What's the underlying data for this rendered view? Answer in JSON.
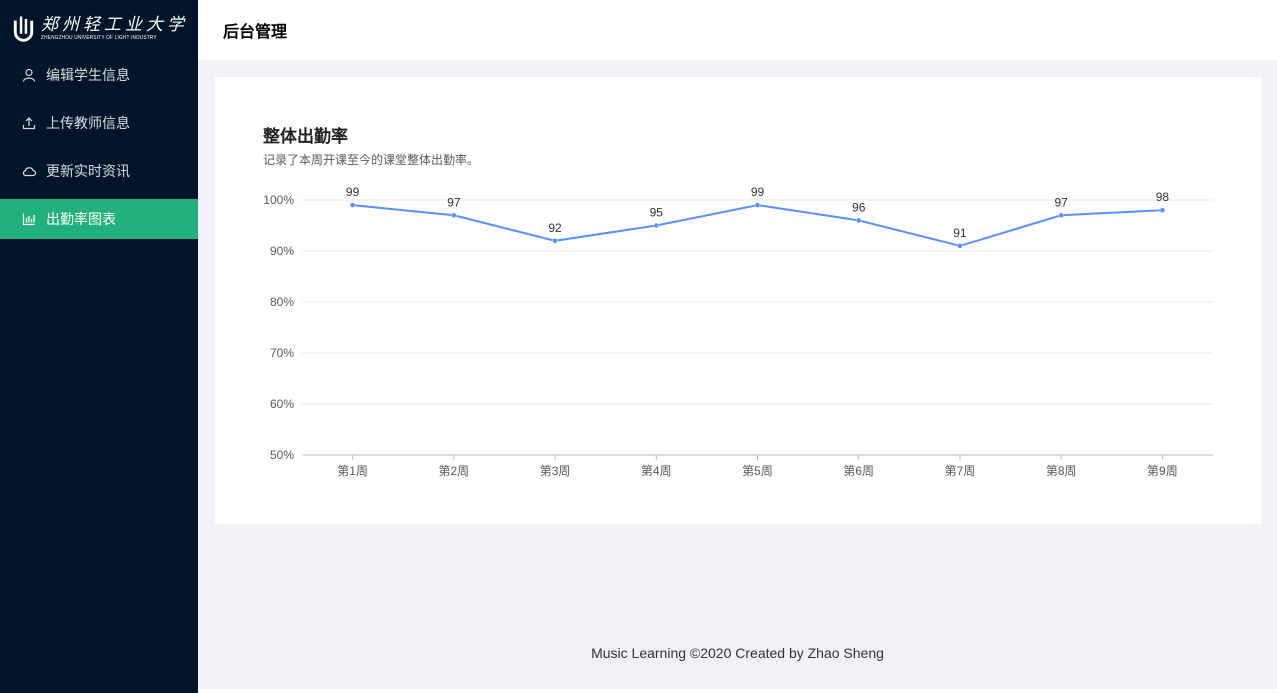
{
  "brand": {
    "logo_cn": "郑州轻工业大学",
    "logo_en": "ZHENGZHOU UNIVERSITY OF LIGHT INDUSTRY"
  },
  "menu": {
    "items": [
      {
        "label": "编辑学生信息",
        "icon": "user-icon"
      },
      {
        "label": "上传教师信息",
        "icon": "upload-icon"
      },
      {
        "label": "更新实时资讯",
        "icon": "cloud-icon"
      },
      {
        "label": "出勤率图表",
        "icon": "bar-chart-icon",
        "active": true
      }
    ]
  },
  "header": {
    "title": "后台管理"
  },
  "card": {
    "title": "整体出勤率",
    "subtitle": "记录了本周开课至今的课堂整体出勤率。"
  },
  "chart_data": {
    "type": "line",
    "categories": [
      "第1周",
      "第2周",
      "第3周",
      "第4周",
      "第5周",
      "第6周",
      "第7周",
      "第8周",
      "第9周"
    ],
    "values": [
      99,
      97,
      92,
      95,
      99,
      96,
      91,
      97,
      98
    ],
    "y_ticks": [
      "100%",
      "90%",
      "80%",
      "70%",
      "60%",
      "50%"
    ],
    "ylim": [
      50,
      100
    ],
    "grid": true,
    "color": "#5b8ff9"
  },
  "footer": {
    "text": "Music Learning ©2020 Created by Zhao Sheng"
  },
  "colors": {
    "sider": "#001529",
    "active": "#22b17c",
    "line": "#5b8ff9"
  }
}
